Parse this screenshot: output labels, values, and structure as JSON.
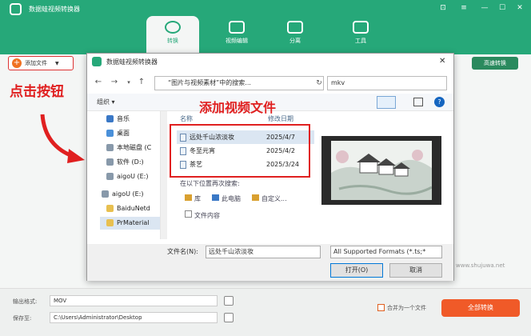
{
  "app": {
    "title": "数据蛙视频转换器",
    "window_buttons": [
      "⊡",
      "≡",
      "—",
      "☐",
      "✕"
    ]
  },
  "tabs": [
    {
      "label": "转换",
      "active": true
    },
    {
      "label": "视频编辑",
      "active": false
    },
    {
      "label": "分离",
      "active": false
    },
    {
      "label": "工具",
      "active": false
    }
  ],
  "main": {
    "add_file_label": "添加文件",
    "add_dropdown": "▼",
    "annotation_click": "点击按钮",
    "right_button": "高速转换"
  },
  "dialog": {
    "title": "数据蛙视频转换器",
    "close": "✕",
    "address": "“图片与视频素材”中的搜索...",
    "search_value": "mkv",
    "organize_label": "组织 ▾",
    "help": "?",
    "annotation_add_video": "添加视频文件",
    "nav_items": [
      "音乐",
      "桌面",
      "本地磁盘 (C",
      "软件 (D:)",
      "aigoU (E:)",
      "aigoU (E:)",
      "BaiduNetd",
      "PrMaterial"
    ],
    "columns": {
      "name": "名称",
      "date": "修改日期"
    },
    "files": [
      {
        "name": "远处千山浓淡妆",
        "date": "2025/4/7"
      },
      {
        "name": "冬至元宵",
        "date": "2025/4/2"
      },
      {
        "name": "茶艺",
        "date": "2025/3/24"
      }
    ],
    "search_again": {
      "label": "在以下位置再次搜索:",
      "items": [
        "库",
        "此电脑",
        "自定义...",
        "文件内容"
      ]
    },
    "filename_label": "文件名(N):",
    "filename_value": "远处千山浓淡妆",
    "filter_value": "All Supported Formats (*.ts;*",
    "open_label": "打开(O)",
    "cancel_label": "取消"
  },
  "bottom": {
    "output_label": "输出格式:",
    "output_value": "MOV",
    "save_label": "保存至:",
    "save_value": "C:\\Users\\Administrator\\Desktop",
    "merge_label": "合并为一个文件",
    "convert_all_label": "全部转换"
  },
  "watermark": "www.shujuwa.net",
  "colors": {
    "brand": "#26a879",
    "accent": "#f05a28",
    "annotation": "#e02020"
  }
}
